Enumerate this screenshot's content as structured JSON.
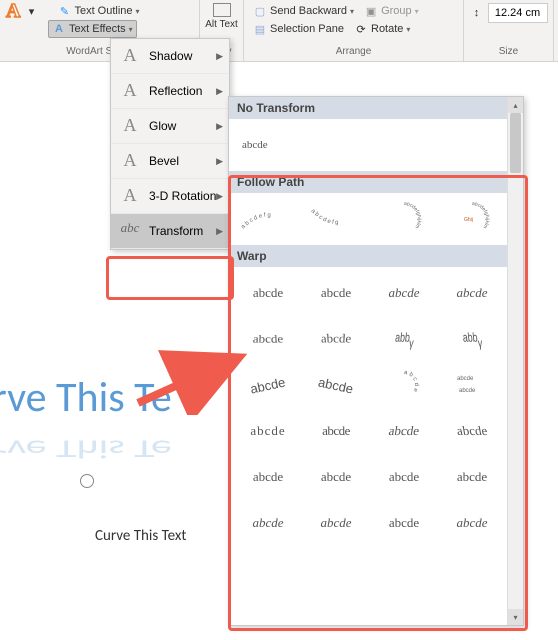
{
  "ribbon": {
    "groups": {
      "wordart": {
        "label": "WordArt Styles",
        "text_outline": "Text Outline",
        "text_effects": "Text Effects"
      },
      "accessibility": {
        "alt_text": "Alt Text",
        "label": "bility"
      },
      "arrange": {
        "label": "Arrange",
        "send_backward": "Send Backward",
        "selection_pane": "Selection Pane",
        "group": "Group",
        "rotate": "Rotate"
      },
      "size": {
        "label": "Size",
        "height_value": "12.24 cm"
      }
    }
  },
  "menu": {
    "shadow": "Shadow",
    "reflection": "Reflection",
    "glow": "Glow",
    "bevel": "Bevel",
    "rotation": "3-D Rotation",
    "transform": "Transform"
  },
  "submenu": {
    "no_transform": "No Transform",
    "no_transform_sample": "abcde",
    "follow_path": "Follow Path",
    "warp": "Warp",
    "sample": "abcde"
  },
  "canvas": {
    "big_text": "urve This Te",
    "small_text": "Curve This Text"
  }
}
